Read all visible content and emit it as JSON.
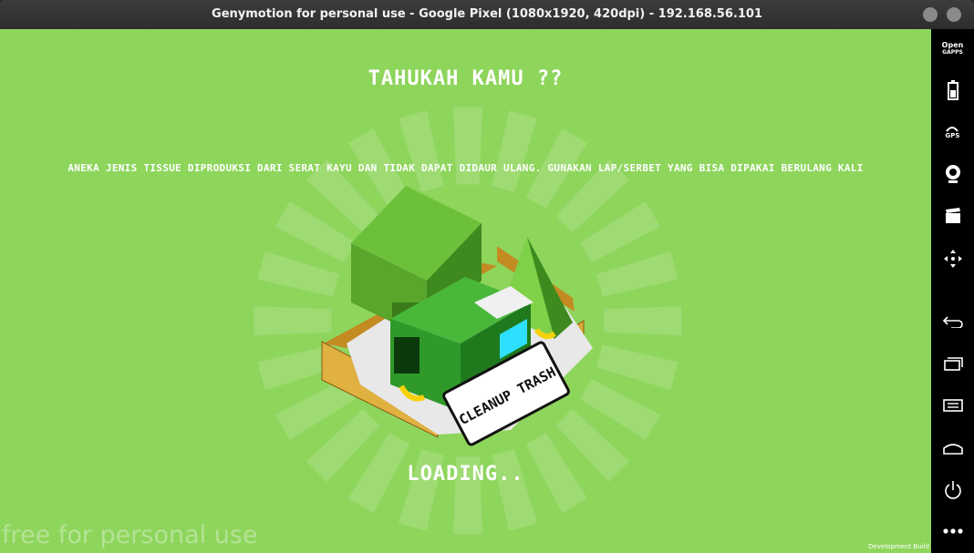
{
  "window": {
    "title": "Genymotion for personal use - Google Pixel (1080x1920, 420dpi) - 192.168.56.101"
  },
  "game": {
    "heading": "TAHUKAH KAMU ??",
    "fact": "ANEKA JENIS TISSUE DIPRODUKSI DARI SERAT KAYU DAN TIDAK DAPAT DIDAUR ULANG. GUNAKAN LAP/SERBET YANG BISA DIPAKAI BERULANG KALI",
    "logo_text": "CLEANUP TRASH",
    "loading": "LOADING..",
    "colors": {
      "background": "#8ed55c",
      "tree": "#5aa52c",
      "truck": "#2f9a2a",
      "fence": "#d9a93a"
    }
  },
  "overlay": {
    "watermark": "free for personal use",
    "dev_build": "Development Build"
  },
  "sidebar": {
    "gapps_top": "Open",
    "gapps_bottom": "GAPPS",
    "gps_label": "GPS",
    "icons": [
      "open-gapps-icon",
      "battery-icon",
      "gps-icon",
      "webcam-icon",
      "clapperboard-icon",
      "move-arrows-icon",
      "back-icon",
      "recent-apps-icon",
      "menu-icon",
      "home-icon",
      "power-icon",
      "more-icon"
    ]
  }
}
